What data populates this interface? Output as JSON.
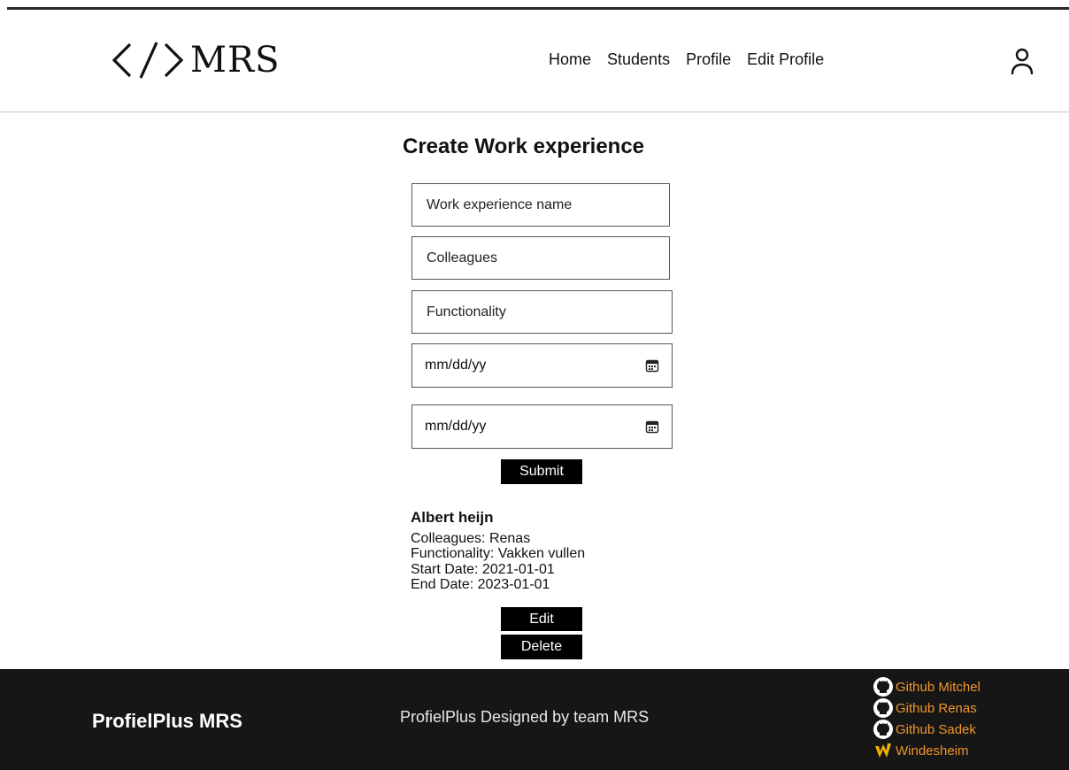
{
  "header": {
    "logo_text": "MRS",
    "nav": [
      "Home",
      "Students",
      "Profile",
      "Edit Profile"
    ]
  },
  "form": {
    "title": "Create Work experience",
    "name_placeholder": "Work experience name",
    "colleagues_placeholder": "Colleagues",
    "functionality_placeholder": "Functionality",
    "start_date": "mm/dd/yy",
    "end_date": "mm/dd/yy",
    "submit_label": "Submit"
  },
  "experience": {
    "name": "Albert heijn",
    "colleagues": "Colleagues: Renas",
    "functionality": "Functionality: Vakken vullen",
    "start_date": "Start Date: 2021-01-01",
    "end_date": "End Date: 2023-01-01",
    "edit_label": "Edit",
    "delete_label": "Delete"
  },
  "footer": {
    "brand": "ProfielPlus MRS",
    "credit": "ProfielPlus Designed by team MRS",
    "links": [
      "Github Mitchel",
      "Github Renas",
      "Github Sadek",
      "Windesheim"
    ]
  },
  "colors": {
    "accent": "#f0952a",
    "footer_bg": "#161616",
    "button_bg": "#000000"
  }
}
